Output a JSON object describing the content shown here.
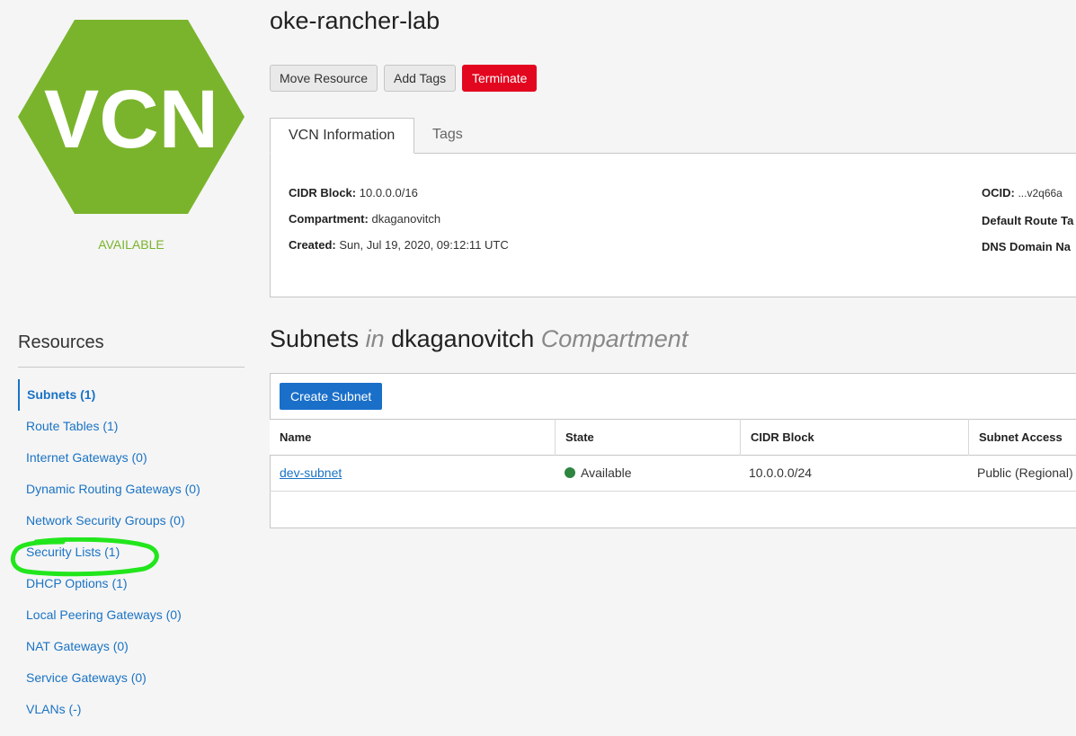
{
  "vcn_badge": {
    "text": "VCN",
    "status": "AVAILABLE",
    "hex_color": "#7ab42c",
    "status_color": "#7ab42c"
  },
  "resources": {
    "title": "Resources",
    "items": [
      {
        "label": "Subnets (1)",
        "active": true
      },
      {
        "label": "Route Tables (1)",
        "active": false
      },
      {
        "label": "Internet Gateways (0)",
        "active": false
      },
      {
        "label": "Dynamic Routing Gateways (0)",
        "active": false
      },
      {
        "label": "Network Security Groups (0)",
        "active": false
      },
      {
        "label": "Security Lists (1)",
        "active": false,
        "highlighted": true
      },
      {
        "label": "DHCP Options (1)",
        "active": false
      },
      {
        "label": "Local Peering Gateways (0)",
        "active": false
      },
      {
        "label": "NAT Gateways (0)",
        "active": false
      },
      {
        "label": "Service Gateways (0)",
        "active": false
      },
      {
        "label": "VLANs (-)",
        "active": false
      }
    ],
    "highlight_color": "#22e61c"
  },
  "header": {
    "title": "oke-rancher-lab",
    "buttons": {
      "move": "Move Resource",
      "tags": "Add Tags",
      "terminate": "Terminate"
    }
  },
  "tabs": {
    "info": "VCN Information",
    "tags": "Tags"
  },
  "info": {
    "cidr_label": "CIDR Block:",
    "cidr_value": "10.0.0.0/16",
    "compartment_label": "Compartment:",
    "compartment_value": "dkaganovitch",
    "created_label": "Created:",
    "created_value": "Sun, Jul 19, 2020, 09:12:11 UTC",
    "ocid_label": "OCID:",
    "ocid_value": "...v2q66a",
    "route_label": "Default Route Ta",
    "dns_label": "DNS Domain Na"
  },
  "subnets": {
    "title_main": "Subnets",
    "title_in": "in",
    "title_compartment": "dkaganovitch",
    "title_suffix": "Compartment",
    "create_button": "Create Subnet",
    "columns": [
      "Name",
      "State",
      "CIDR Block",
      "Subnet Access"
    ],
    "rows": [
      {
        "name": "dev-subnet",
        "state": "Available",
        "cidr": "10.0.0.0/24",
        "access": "Public (Regional)"
      }
    ],
    "available_color": "#2e8540"
  }
}
